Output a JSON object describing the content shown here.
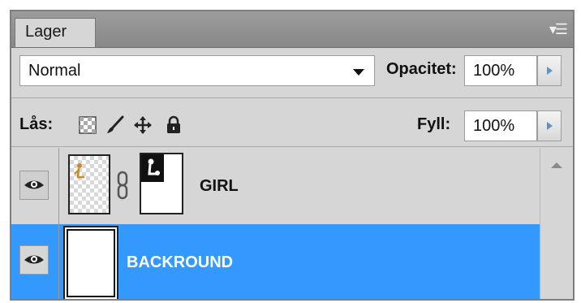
{
  "panel": {
    "tab_label": "Lager",
    "menu_icon": "panel-menu-icon"
  },
  "blend": {
    "mode": "Normal",
    "opacity_label": "Opacitet:",
    "opacity_value": "100%"
  },
  "lock": {
    "label": "Lås:",
    "icons": [
      "lock-transparent-pixels-icon",
      "lock-image-pixels-icon",
      "lock-position-icon",
      "lock-all-icon"
    ],
    "fill_label": "Fyll:",
    "fill_value": "100%"
  },
  "layers": [
    {
      "name": "GIRL",
      "visible": true,
      "selected": false,
      "has_mask": true
    },
    {
      "name": "BACKROUND",
      "visible": true,
      "selected": true,
      "has_mask": false
    }
  ],
  "colors": {
    "selection": "#3399ff",
    "panel_bg": "#d6d6d6"
  }
}
